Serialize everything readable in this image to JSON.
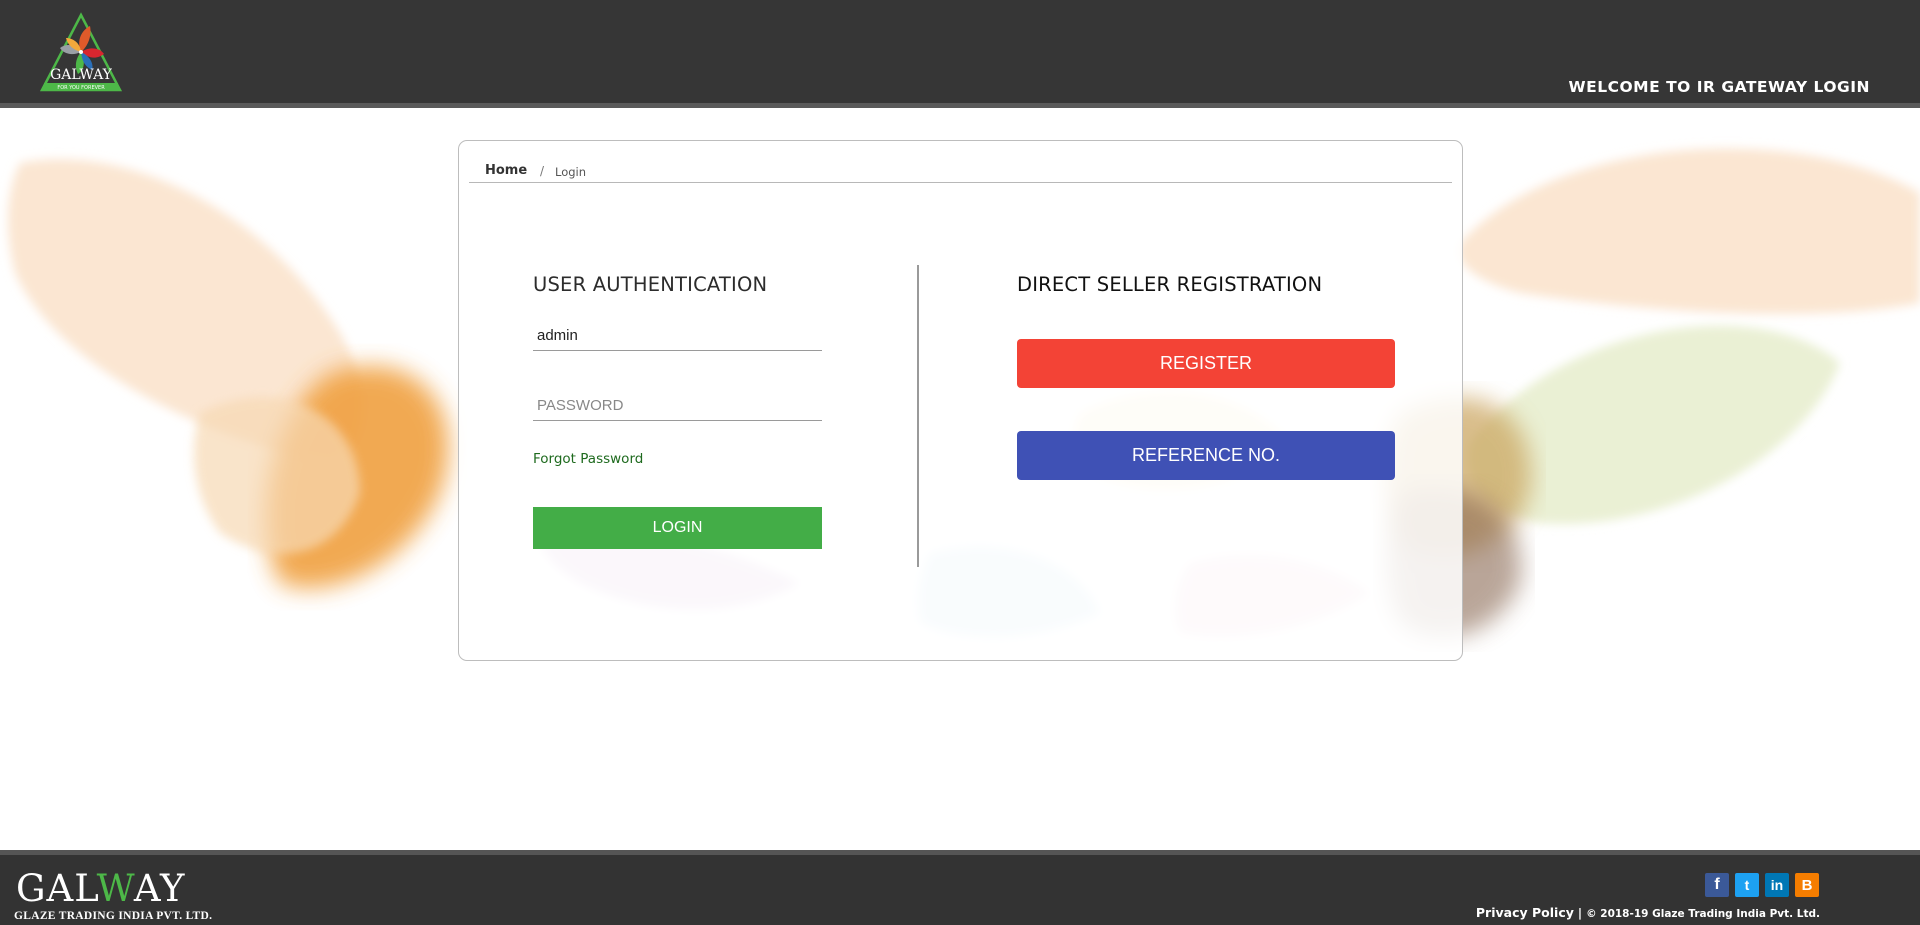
{
  "header": {
    "title": "WELCOME TO IR GATEWAY LOGIN",
    "logo_text": "GALWAY",
    "logo_tagline": "FOR YOU FOREVER"
  },
  "breadcrumb": {
    "home": "Home",
    "separator": "/",
    "current": "Login"
  },
  "auth": {
    "title": "USER AUTHENTICATION",
    "username_value": "admin",
    "password_placeholder": "PASSWORD",
    "forgot_label": "Forgot Password",
    "login_label": "LOGIN"
  },
  "registration": {
    "title": "DIRECT SELLER REGISTRATION",
    "register_label": "REGISTER",
    "reference_label": "REFERENCE NO."
  },
  "footer": {
    "brand_prefix": "GAL",
    "brand_w": "W",
    "brand_suffix": "AY",
    "tagline": "GLAZE TRADING INDIA PVT. LTD.",
    "privacy": "Privacy Policy",
    "separator": "|",
    "copyright": "© 2018-19 Glaze Trading India Pvt. Ltd.",
    "social": {
      "facebook": "f",
      "twitter": "t",
      "linkedin": "in",
      "blogger": "B"
    }
  },
  "colors": {
    "header_bg": "#363636",
    "login_green": "#43ad47",
    "register_red": "#f34336",
    "reference_blue": "#3f51b5",
    "forgot_green": "#1e6a1e"
  }
}
